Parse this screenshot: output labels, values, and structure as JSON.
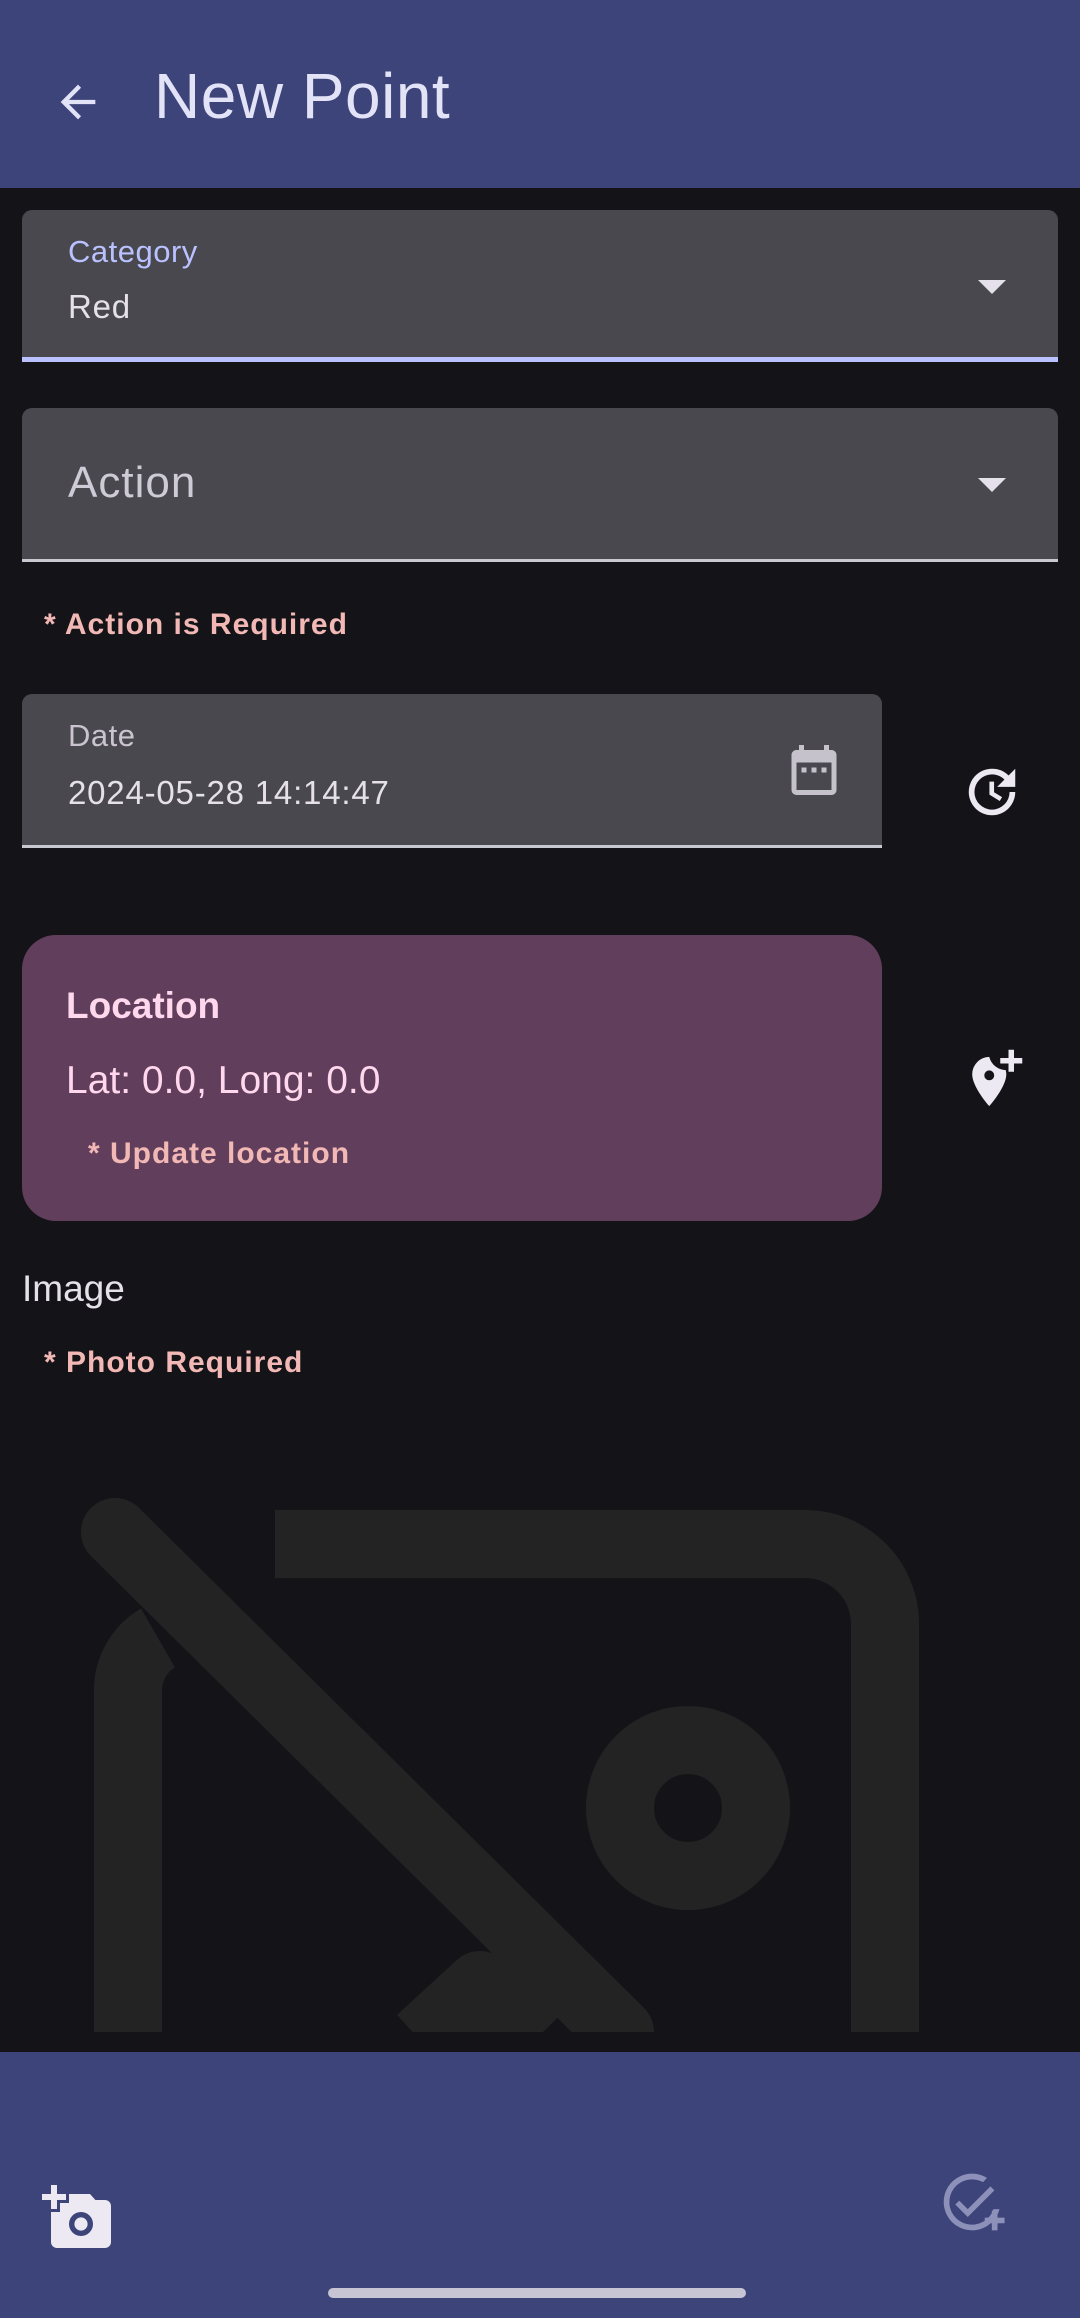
{
  "appbar": {
    "title": "New Point",
    "back_icon": "arrow-back-icon"
  },
  "category": {
    "label": "Category",
    "value": "Red"
  },
  "action": {
    "placeholder": "Action",
    "error": "* Action is Required"
  },
  "date": {
    "label": "Date",
    "value": "2024-05-28 14:14:47",
    "calendar_icon": "calendar-icon",
    "reset_icon": "restore-time-icon"
  },
  "location": {
    "title": "Location",
    "coords": "Lat: 0.0, Long: 0.0",
    "error": "* Update location",
    "add_location_icon": "add-location-icon"
  },
  "image": {
    "heading": "Image",
    "error": "* Photo Required",
    "placeholder_icon": "no-photography-icon"
  },
  "bottombar": {
    "add_photo_icon": "add-photo-icon",
    "save_icon": "check-circle-add-icon"
  },
  "colors": {
    "appbar": "#3d447a",
    "background": "#141318",
    "field": "#48484e",
    "accent_underline": "#b9c1ff",
    "error": "#f2b8b5",
    "location_card": "#613e5b"
  }
}
